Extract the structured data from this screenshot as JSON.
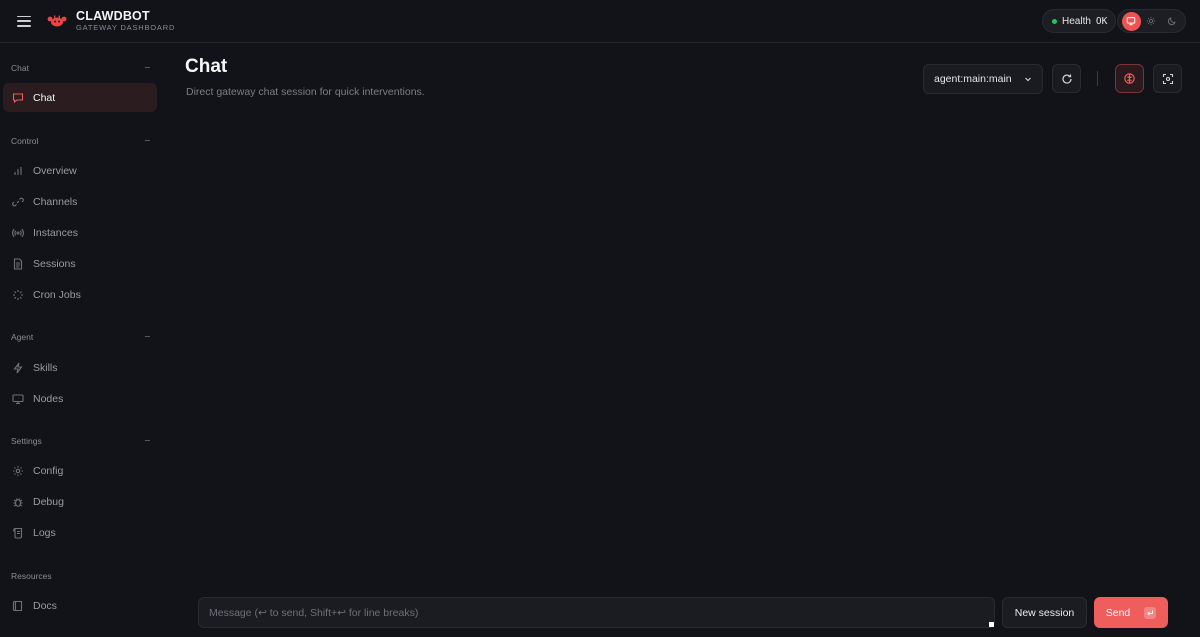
{
  "app": {
    "name": "CLAWDBOT",
    "subtitle": "GATEWAY DASHBOARD"
  },
  "header": {
    "health_label": "Health",
    "health_status": "OK",
    "theme_modes": [
      "system-icon",
      "sun-icon",
      "moon-icon"
    ],
    "theme_selected": "system"
  },
  "sidebar": {
    "sections": [
      {
        "title": "Chat",
        "items": [
          {
            "label": "Chat",
            "icon": "chat-bubble-icon",
            "active": true
          }
        ]
      },
      {
        "title": "Control",
        "items": [
          {
            "label": "Overview",
            "icon": "bar-chart-icon"
          },
          {
            "label": "Channels",
            "icon": "link-icon"
          },
          {
            "label": "Instances",
            "icon": "broadcast-icon"
          },
          {
            "label": "Sessions",
            "icon": "document-icon"
          },
          {
            "label": "Cron Jobs",
            "icon": "loader-icon"
          }
        ]
      },
      {
        "title": "Agent",
        "items": [
          {
            "label": "Skills",
            "icon": "lightning-icon"
          },
          {
            "label": "Nodes",
            "icon": "monitor-icon"
          }
        ]
      },
      {
        "title": "Settings",
        "items": [
          {
            "label": "Config",
            "icon": "gear-icon"
          },
          {
            "label": "Debug",
            "icon": "bug-icon"
          },
          {
            "label": "Logs",
            "icon": "scroll-icon"
          }
        ]
      },
      {
        "title": "Resources",
        "items": [
          {
            "label": "Docs",
            "icon": "book-icon"
          }
        ]
      }
    ]
  },
  "main": {
    "title": "Chat",
    "subtitle": "Direct gateway chat session for quick interventions.",
    "session_select": {
      "value": "agent:main:main"
    },
    "composer": {
      "placeholder": "Message (↩ to send, Shift+↩ for line breaks)",
      "value": ""
    },
    "buttons": {
      "new_session": "New session",
      "send": "Send"
    }
  },
  "colors": {
    "accent": "#f05d5d",
    "background": "#121318",
    "health_dot": "#22c55e",
    "active_nav_bg": "#2a1c1f"
  }
}
